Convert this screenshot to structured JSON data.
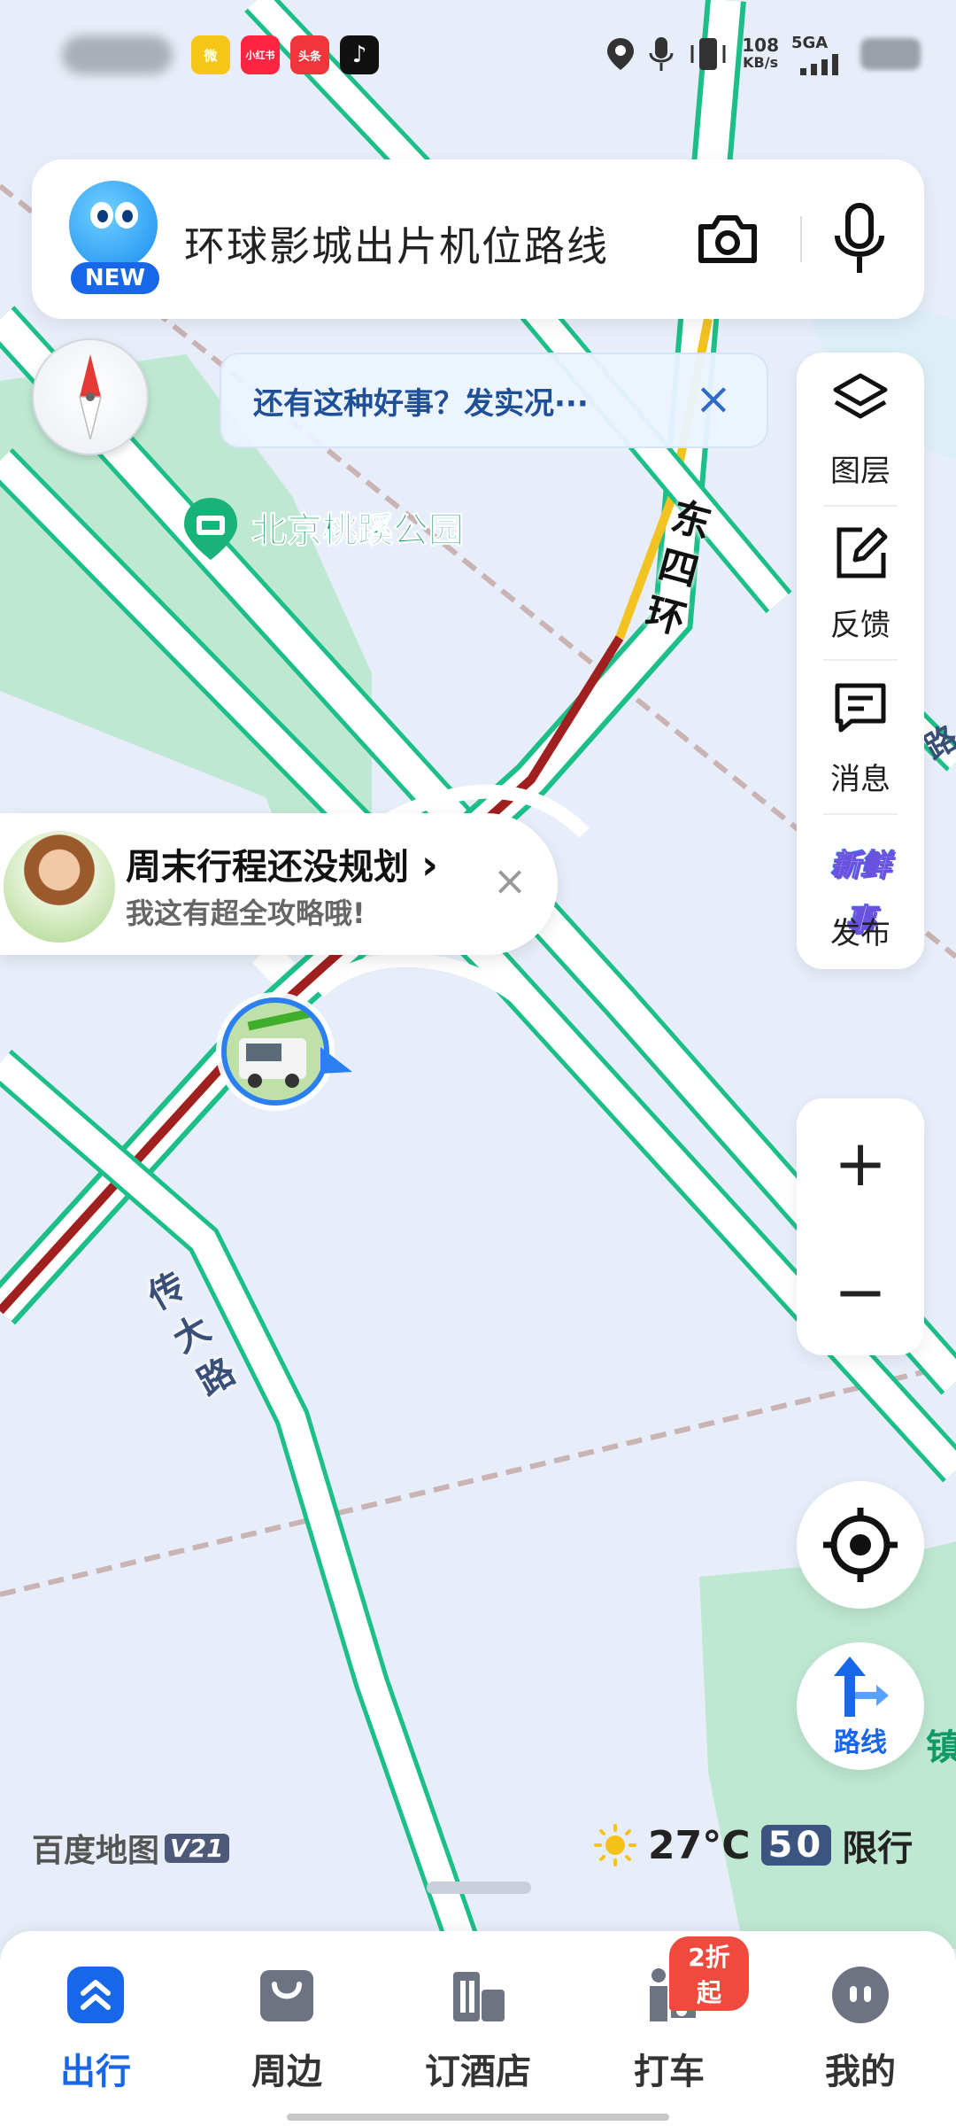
{
  "status_bar": {
    "apps": [
      {
        "name": "weibo-icon",
        "text": "微",
        "color": "#f5c518"
      },
      {
        "name": "xiaohongshu-icon",
        "text": "小红书",
        "color": "#ff2442"
      },
      {
        "name": "toutiao-icon",
        "text": "头条",
        "color": "#f0353b"
      },
      {
        "name": "tiktok-icon",
        "text": "♪",
        "color": "#111111"
      }
    ],
    "net_speed_value": "108",
    "net_speed_unit": "KB/s",
    "net_type": "5GA"
  },
  "search": {
    "badge": "NEW",
    "text": "环球影城出片机位路线",
    "camera_icon": "camera-icon",
    "mic_icon": "microphone-icon"
  },
  "tip": {
    "text": "还有这种好事？发实况···",
    "close": "×"
  },
  "toolbar": {
    "items": [
      {
        "label": "图层",
        "icon": "layers-icon"
      },
      {
        "label": "反馈",
        "icon": "edit-feedback-icon"
      },
      {
        "label": "消息",
        "icon": "message-icon"
      },
      {
        "label": "发布",
        "icon": "fresh-news-icon",
        "art": "新鲜事"
      }
    ]
  },
  "map": {
    "poi": "北京桃蹊公园",
    "road_east4": "东四环",
    "road_chuanda": "传大路",
    "road_partial_right": "路",
    "road_partial_bottom_right": "镇",
    "colors": {
      "road_green": "#1dbf88",
      "road_red": "#a01f1f",
      "road_yellow": "#f3c322",
      "park": "#bfe8d2"
    }
  },
  "bubble": {
    "title": "周末行程还没规划",
    "arrow": "›",
    "subtitle": "我这有超全攻略哦!",
    "close": "×"
  },
  "zoom": {
    "in": "+",
    "out": "−"
  },
  "route": {
    "label": "路线"
  },
  "footer": {
    "logo": "百度地图",
    "logo_version": "V21",
    "temperature": "27°C",
    "limit_number": "50",
    "limit_label": "限行"
  },
  "bottom_nav": {
    "items": [
      {
        "label": "出行",
        "icon": "travel-icon",
        "active": true
      },
      {
        "label": "周边",
        "icon": "nearby-bag-icon",
        "active": false
      },
      {
        "label": "订酒店",
        "icon": "hotel-icon",
        "active": false
      },
      {
        "label": "打车",
        "icon": "taxi-icon",
        "active": false,
        "badge": "2折起"
      },
      {
        "label": "我的",
        "icon": "profile-icon",
        "active": false
      }
    ]
  }
}
